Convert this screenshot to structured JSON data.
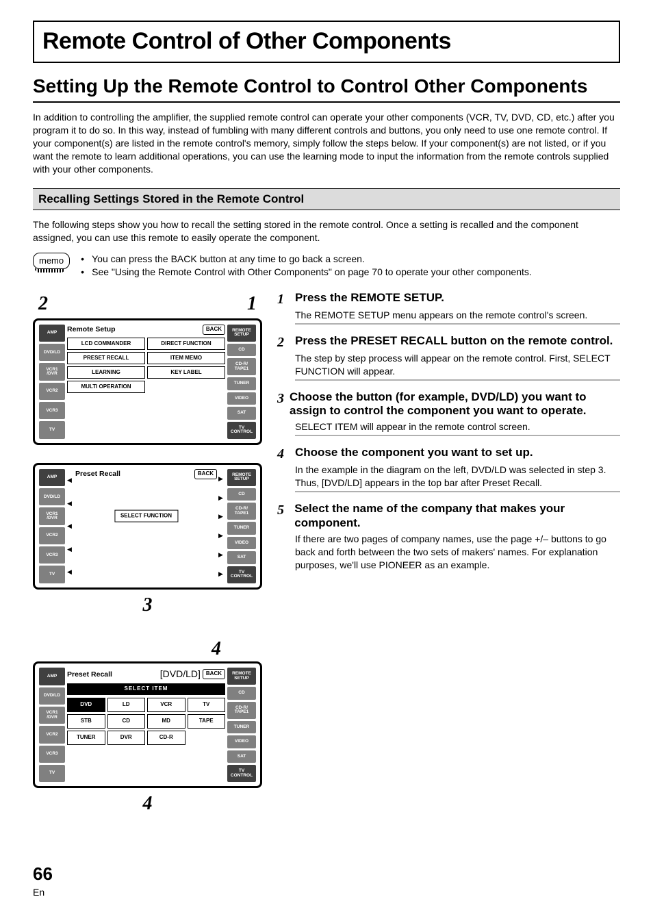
{
  "title_bar": "Remote Control of Other Components",
  "section_heading": "Setting Up the Remote Control to Control Other Components",
  "intro": "In addition to controlling the amplifier, the supplied remote control can operate your other components (VCR, TV, DVD, CD, etc.) after you program it to do so. In this way, instead of fumbling with many different controls and buttons, you only need to use one remote control. If your component(s) are listed in the remote control's memory, simply follow the steps below. If your component(s) are not listed, or if you want the remote to learn additional operations, you can use the learning mode to input the information from the remote controls supplied with your other components.",
  "sub_heading": "Recalling Settings Stored in the Remote Control",
  "sub_intro": "The following steps show you how to recall the setting stored in the remote control. Once a setting is recalled and the component assigned, you can use this remote to easily operate the component.",
  "memo_label": "memo",
  "memo_items": [
    "You can press the BACK button at any time to go back a screen.",
    "See \"Using the Remote Control with Other Components\" on page 70 to operate your other components."
  ],
  "callouts": {
    "c1": "1",
    "c2": "2",
    "c3": "3",
    "c4": "4",
    "c4b": "4"
  },
  "remote_side_left": [
    "AMP",
    "DVD/LD",
    "VCR1\n/DVR",
    "VCR2",
    "VCR3",
    "TV"
  ],
  "remote_side_right": [
    "REMOTE\nSETUP",
    "CD",
    "CD-R/\nTAPE1",
    "TUNER",
    "VIDEO",
    "SAT",
    "TV\nCONTROL"
  ],
  "d1": {
    "title": "Remote Setup",
    "back": "BACK",
    "buttons": [
      "LCD\nCOMMANDER",
      "DIRECT FUNCTION",
      "PRESET RECALL",
      "ITEM MEMO",
      "LEARNING",
      "KEY LABEL",
      "MULTI OPERATION"
    ]
  },
  "d2": {
    "title": "Preset Recall",
    "back": "BACK",
    "center": "SELECT FUNCTION"
  },
  "d3": {
    "title": "Preset Recall",
    "bracket": "[DVD/LD]",
    "back": "BACK",
    "bar": "SELECT ITEM",
    "items_row1": [
      "DVD",
      "LD",
      "VCR",
      "TV"
    ],
    "items_row2": [
      "STB",
      "CD",
      "MD",
      "TAPE"
    ],
    "items_row3": [
      "TUNER",
      "DVR",
      "CD-R",
      ""
    ]
  },
  "steps": [
    {
      "num": "1",
      "title": "Press the REMOTE SETUP.",
      "desc": "The REMOTE SETUP menu appears on the remote control's screen."
    },
    {
      "num": "2",
      "title": "Press the PRESET RECALL button on the remote control.",
      "desc": "The step by step process will appear on the remote control. First, SELECT FUNCTION will appear."
    },
    {
      "num": "3",
      "title": "Choose the button (for example, DVD/LD) you want to assign to control the component you want to operate.",
      "desc": "SELECT ITEM will appear in the remote control screen."
    },
    {
      "num": "4",
      "title": "Choose the component you want to set up.",
      "desc": "In the example in the diagram on the left, DVD/LD was selected in step 3. Thus, [DVD/LD] appears in the top bar after Preset Recall."
    },
    {
      "num": "5",
      "title": "Select the name of the company that makes your component.",
      "desc": "If there are two pages of company names, use the page +/– buttons to go back and forth between the two sets of makers' names. For explanation purposes, we'll use PIONEER as an example."
    }
  ],
  "page": {
    "number": "66",
    "lang": "En"
  }
}
